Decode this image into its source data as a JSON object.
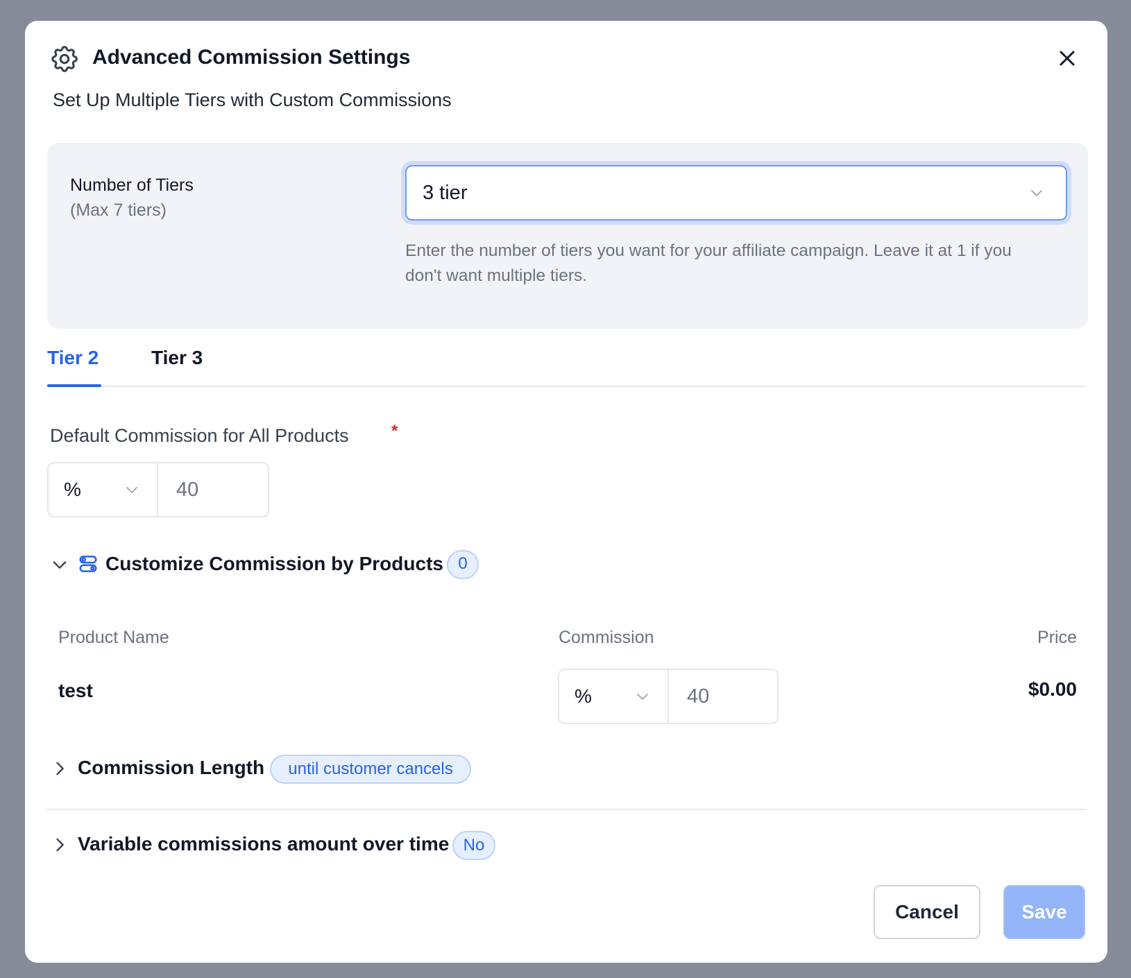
{
  "dialog": {
    "title": "Advanced Commission Settings",
    "subtitle": "Set Up Multiple Tiers with Custom Commissions",
    "icons": {
      "header": "gear-icon",
      "close": "close-icon"
    }
  },
  "tiers": {
    "label": "Number of Tiers",
    "sublabel": "(Max 7 tiers)",
    "selected": "3 tier",
    "help": "Enter the number of tiers you want for your affiliate campaign. Leave it at 1 if you don't want multiple tiers."
  },
  "tabs": [
    {
      "label": "Tier 2",
      "active": true
    },
    {
      "label": "Tier 3",
      "active": false
    }
  ],
  "default_commission": {
    "label": "Default Commission for All Products",
    "required_mark": "*",
    "unit": "%",
    "value": "40"
  },
  "customize": {
    "title": "Customize Commission by Products",
    "count": "0",
    "expanded": true,
    "table": {
      "headers": [
        "Product Name",
        "Commission",
        "Price"
      ],
      "rows": [
        {
          "name": "test",
          "unit": "%",
          "value": "40",
          "price": "$0.00"
        }
      ]
    }
  },
  "commission_length": {
    "title": "Commission Length",
    "badge": "until customer cancels"
  },
  "variable_commissions": {
    "title": "Variable commissions amount over time",
    "badge": "No"
  },
  "footer": {
    "cancel_label": "Cancel",
    "save_label": "Save"
  },
  "colors": {
    "accent": "#2563eb",
    "save_disabled": "#93b4f7",
    "backdrop": "#858b98",
    "required": "#dc2626"
  }
}
